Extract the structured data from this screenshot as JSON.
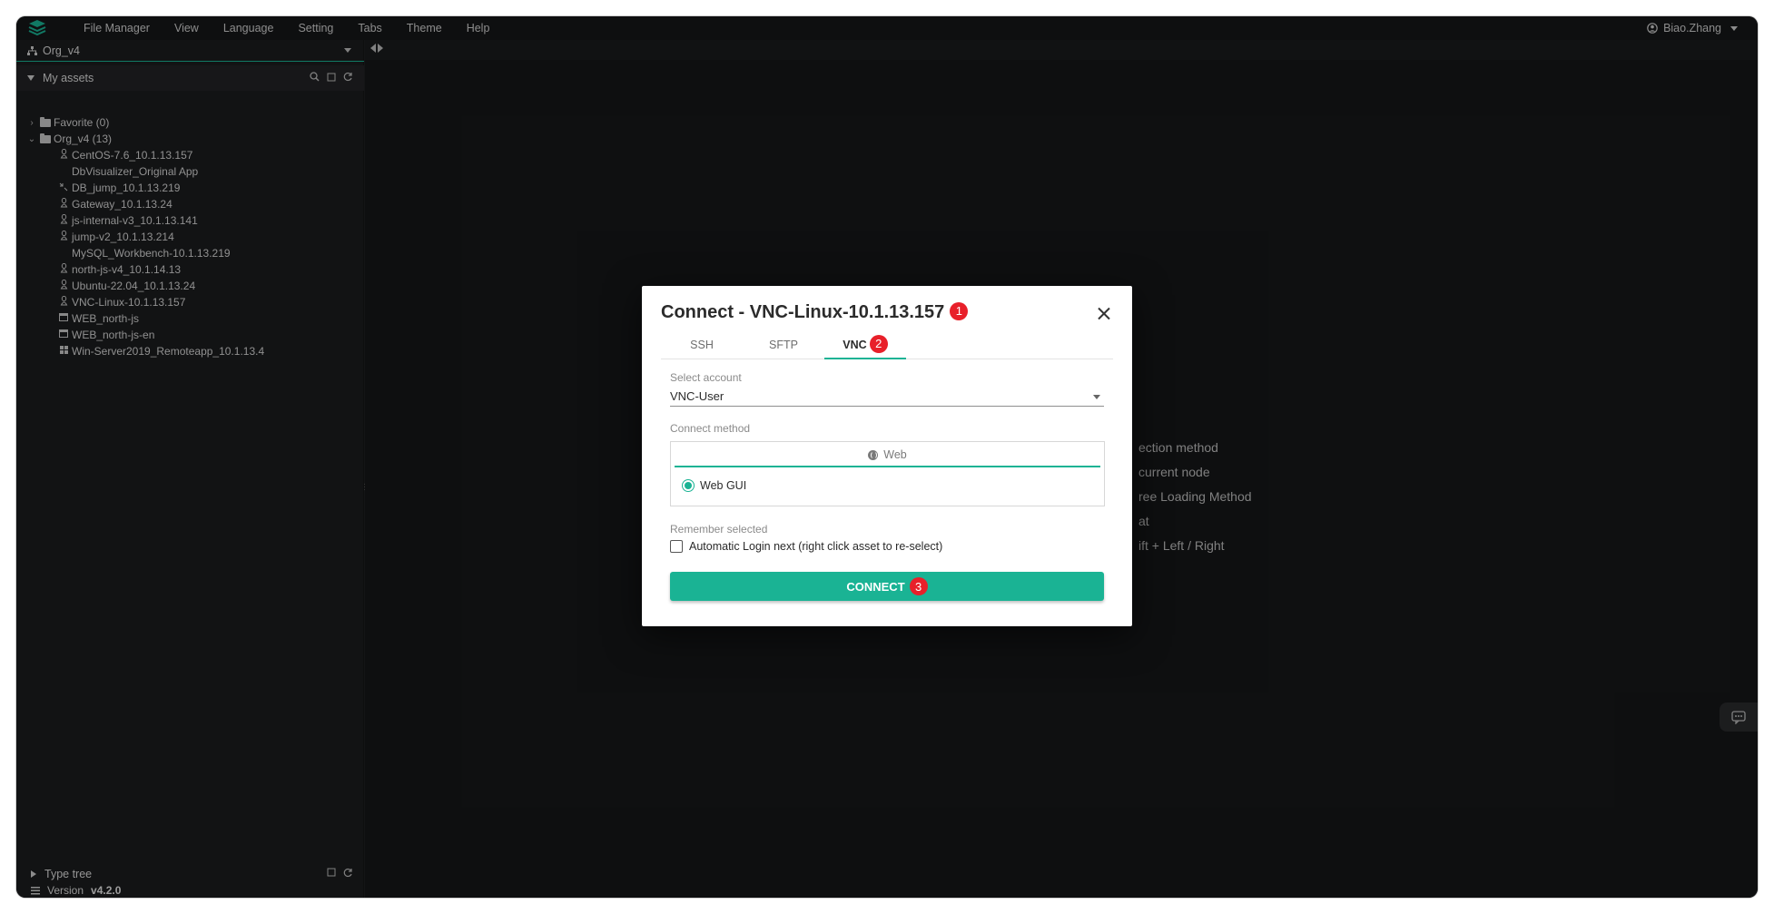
{
  "menubar": {
    "items": [
      "File Manager",
      "View",
      "Language",
      "Setting",
      "Tabs",
      "Theme",
      "Help"
    ],
    "user": "Biao.Zhang"
  },
  "sidebar": {
    "org": "Org_v4",
    "assets_title": "My assets",
    "favorite": "Favorite (0)",
    "org_node": "Org_v4 (13)",
    "assets": [
      {
        "icon": "linux-icon",
        "label": "CentOS-7.6_10.1.13.157"
      },
      {
        "icon": "",
        "label": "DbVisualizer_Original App"
      },
      {
        "icon": "database-icon",
        "label": "DB_jump_10.1.13.219"
      },
      {
        "icon": "linux-icon",
        "label": "Gateway_10.1.13.24"
      },
      {
        "icon": "linux-icon",
        "label": "js-internal-v3_10.1.13.141"
      },
      {
        "icon": "linux-icon",
        "label": "jump-v2_10.1.13.214"
      },
      {
        "icon": "",
        "label": "MySQL_Workbench-10.1.13.219"
      },
      {
        "icon": "linux-icon",
        "label": "north-js-v4_10.1.14.13"
      },
      {
        "icon": "linux-icon",
        "label": "Ubuntu-22.04_10.1.13.24"
      },
      {
        "icon": "linux-icon",
        "label": "VNC-Linux-10.1.13.157"
      },
      {
        "icon": "web-icon",
        "label": "WEB_north-js"
      },
      {
        "icon": "web-icon",
        "label": "WEB_north-js-en"
      },
      {
        "icon": "windows-icon",
        "label": "Win-Server2019_Remoteapp_10.1.13.4"
      }
    ],
    "type_tree": "Type tree",
    "version_label": "Version",
    "version_value": "v4.2.0"
  },
  "main": {
    "hints": [
      "ection method",
      "current node",
      "ree Loading Method",
      "at",
      "ift + Left / Right"
    ]
  },
  "dialog": {
    "title": "Connect - VNC-Linux-10.1.13.157",
    "badge_1": "1",
    "tabs": [
      "SSH",
      "SFTP",
      "VNC"
    ],
    "badge_2": "2",
    "select_account_label": "Select account",
    "account_value": "VNC-User",
    "connect_method_label": "Connect method",
    "method_tab": "Web",
    "method_option": "Web GUI",
    "remember_label": "Remember selected",
    "auto_login": "Automatic Login next (right click asset to re-select)",
    "connect_button": "CONNECT",
    "badge_3": "3"
  },
  "colors": {
    "accent": "#1ab394",
    "badge": "#e8202a",
    "window_bg": "#1e1f21"
  }
}
